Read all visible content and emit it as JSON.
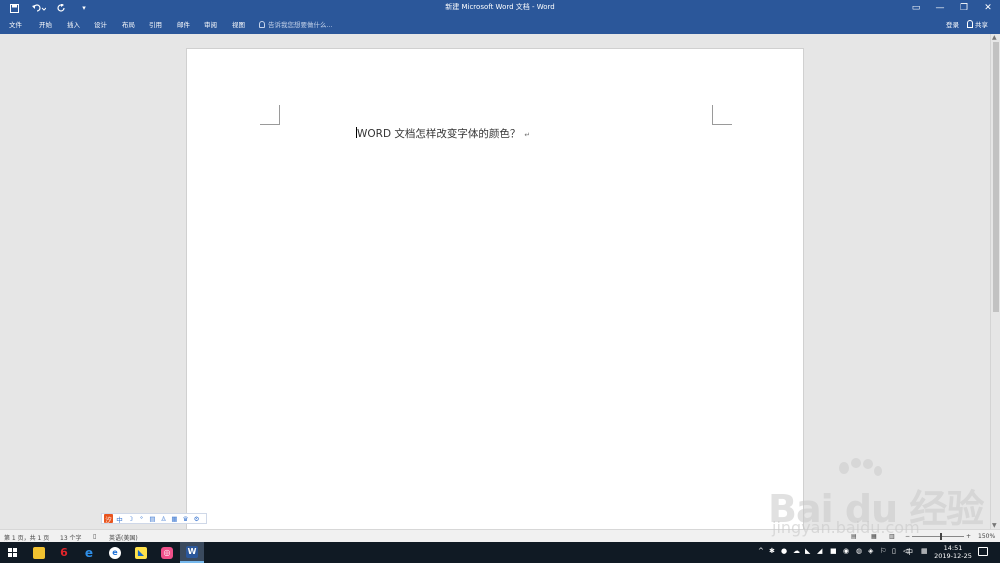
{
  "window": {
    "title": "新建 Microsoft Word 文档 - Word",
    "quick_access": {
      "save_icon": "save-icon",
      "undo_icon": "undo-icon",
      "redo_icon": "redo-icon",
      "customize_icon": "customize-icon"
    },
    "controls": {
      "ribbon_display": "▭",
      "minimize": "—",
      "restore": "❐",
      "close": "✕"
    }
  },
  "ribbon": {
    "tabs": [
      "文件",
      "开始",
      "插入",
      "设计",
      "布局",
      "引用",
      "邮件",
      "审阅",
      "视图"
    ],
    "tell_me_placeholder": "告诉我您想要做什么...",
    "login": "登录",
    "share": "共享"
  },
  "document": {
    "text": "WORD  文档怎样改变字体的颜色？",
    "paragraph_mark": "↵"
  },
  "ime": {
    "items": [
      "汐",
      "中",
      "☽",
      "°",
      "▤",
      "♙",
      "▦",
      "♛",
      "⚙"
    ]
  },
  "status": {
    "page": "第 1 页，共 1 页",
    "words": "13 个字",
    "language": "英语(美国)",
    "zoom": "150%",
    "zoom_minus": "−",
    "zoom_plus": "+"
  },
  "taskbar": {
    "time": "14:51",
    "date": "2019-12-25",
    "tray": [
      "^",
      "✱",
      "●",
      "☁",
      "◣",
      "◢",
      "■",
      "◉",
      "◍",
      "◈",
      "⚐",
      "▯",
      "◁",
      "中",
      "▦"
    ]
  },
  "watermark": {
    "brand": "Bai  du 经验",
    "url": "jingyan.baidu.com"
  },
  "colors": {
    "title_bar": "#2b579a",
    "taskbar": "#101a24",
    "page": "#ffffff"
  }
}
